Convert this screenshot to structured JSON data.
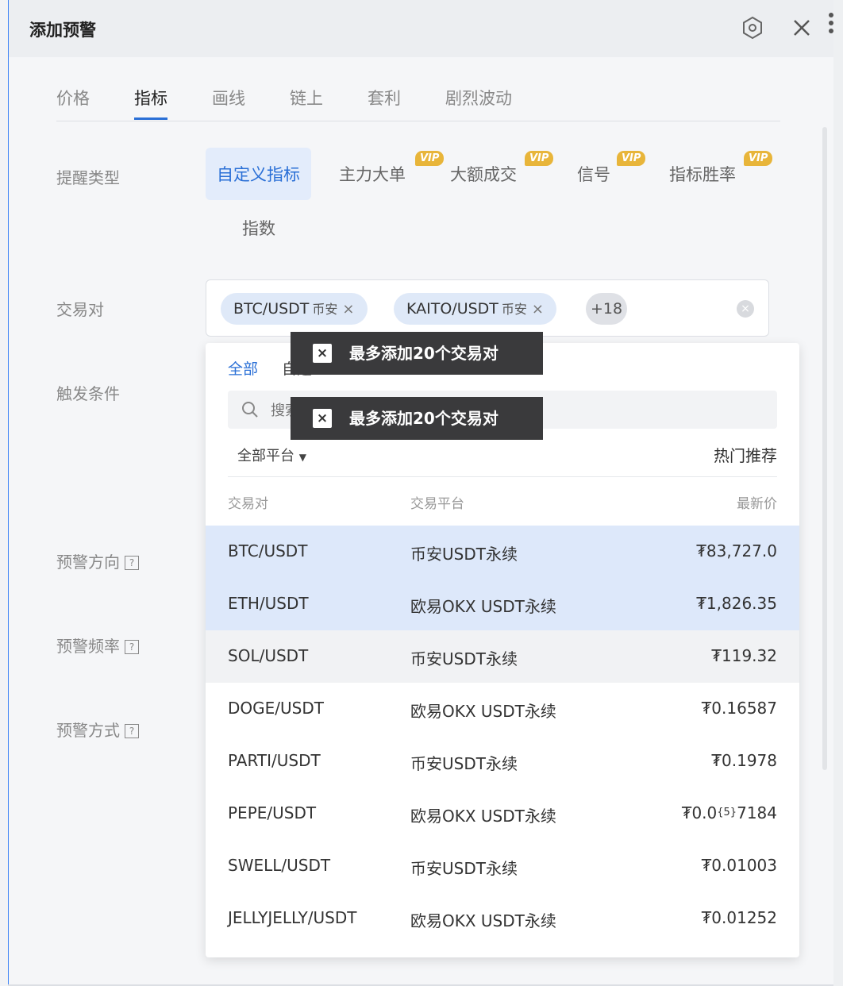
{
  "header": {
    "title": "添加预警"
  },
  "tabs": [
    {
      "label": "价格",
      "active": false
    },
    {
      "label": "指标",
      "active": true
    },
    {
      "label": "画线",
      "active": false
    },
    {
      "label": "链上",
      "active": false
    },
    {
      "label": "套利",
      "active": false
    },
    {
      "label": "剧烈波动",
      "active": false
    }
  ],
  "labels": {
    "alert_type": "提醒类型",
    "trading_pair": "交易对",
    "trigger": "触发条件",
    "direction": "预警方向",
    "frequency": "预警频率",
    "method": "预警方式",
    "help_mark": "?"
  },
  "alert_types": [
    {
      "label": "自定义指标",
      "vip": "",
      "active": true
    },
    {
      "label": "主力大单",
      "vip": "VIP"
    },
    {
      "label": "大额成交",
      "vip": "VIP"
    },
    {
      "label": "信号",
      "vip": "VIP"
    },
    {
      "label": "指标胜率",
      "vip": "VIP"
    },
    {
      "label": "指数",
      "vip": ""
    }
  ],
  "selected_pairs": [
    {
      "pair": "BTC/USDT",
      "exchange": "币安",
      "close": "×"
    },
    {
      "pair": "KAITO/USDT",
      "exchange": "币安",
      "close": "×"
    }
  ],
  "more_count": "+18",
  "clear_icon": "×",
  "dropdown": {
    "tab_all": "全部",
    "tab_fav": "自选",
    "search_placeholder": "搜索交易对",
    "platform": "全部平台",
    "hot": "热门推荐",
    "columns": {
      "pair": "交易对",
      "platform": "交易平台",
      "price": "最新价"
    },
    "rows": [
      {
        "pair": "BTC/USDT",
        "platform": "币安USDT永续",
        "price": "₮83,727.0",
        "state": "selected"
      },
      {
        "pair": "ETH/USDT",
        "platform": "欧易OKX USDT永续",
        "price": "₮1,826.35",
        "state": "selected"
      },
      {
        "pair": "SOL/USDT",
        "platform": "币安USDT永续",
        "price": "₮119.32",
        "state": "hover"
      },
      {
        "pair": "DOGE/USDT",
        "platform": "欧易OKX USDT永续",
        "price": "₮0.16587",
        "state": ""
      },
      {
        "pair": "PARTI/USDT",
        "platform": "币安USDT永续",
        "price": "₮0.1978",
        "state": ""
      },
      {
        "pair": "PEPE/USDT",
        "platform": "欧易OKX USDT永续",
        "price_main": "₮0.0",
        "price_sub": "{5}",
        "price_tail": "7184",
        "state": ""
      },
      {
        "pair": "SWELL/USDT",
        "platform": "币安USDT永续",
        "price": "₮0.01003",
        "state": ""
      },
      {
        "pair": "JELLYJELLY/USDT",
        "platform": "欧易OKX USDT永续",
        "price": "₮0.01252",
        "state": ""
      }
    ]
  },
  "toast": {
    "message": "最多添加20个交易对",
    "close": "×"
  },
  "colors": {
    "accent": "#2a6fd6",
    "vip": "#e8b53a",
    "selected_row": "#dde8fa"
  }
}
